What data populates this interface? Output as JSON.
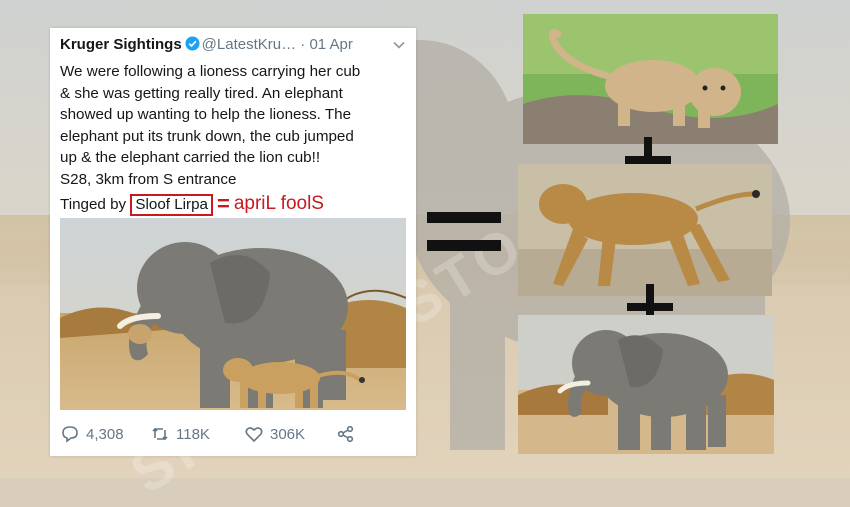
{
  "tweet": {
    "name": "Kruger Sightings",
    "handle": "@LatestKru…",
    "date": "· 01 Apr",
    "lines": [
      "We were following a lioness carrying her cub",
      "& she was getting really tired. An elephant",
      "showed up wanting to help the lioness. The",
      "elephant put its trunk down, the cub jumped",
      "up & the elephant carried the lion cub!!",
      "S28, 3km from S entrance"
    ],
    "tinged_prefix": "Tinged by",
    "tinged_name": "Sloof Lirpa",
    "actions": {
      "replies": "4,308",
      "retweets": "118K",
      "likes": "306K"
    }
  },
  "annotation": {
    "equals": "=",
    "text": "apriL foolS",
    "color": "#c8191e"
  },
  "icons": [
    "verified-badge-icon",
    "chevron-down-icon",
    "reply-icon",
    "retweet-icon",
    "like-icon",
    "share-icon"
  ],
  "colors": {
    "twitter_blue": "#1da1f2",
    "annotation_red": "#c8191e",
    "muted_text": "#657786"
  }
}
